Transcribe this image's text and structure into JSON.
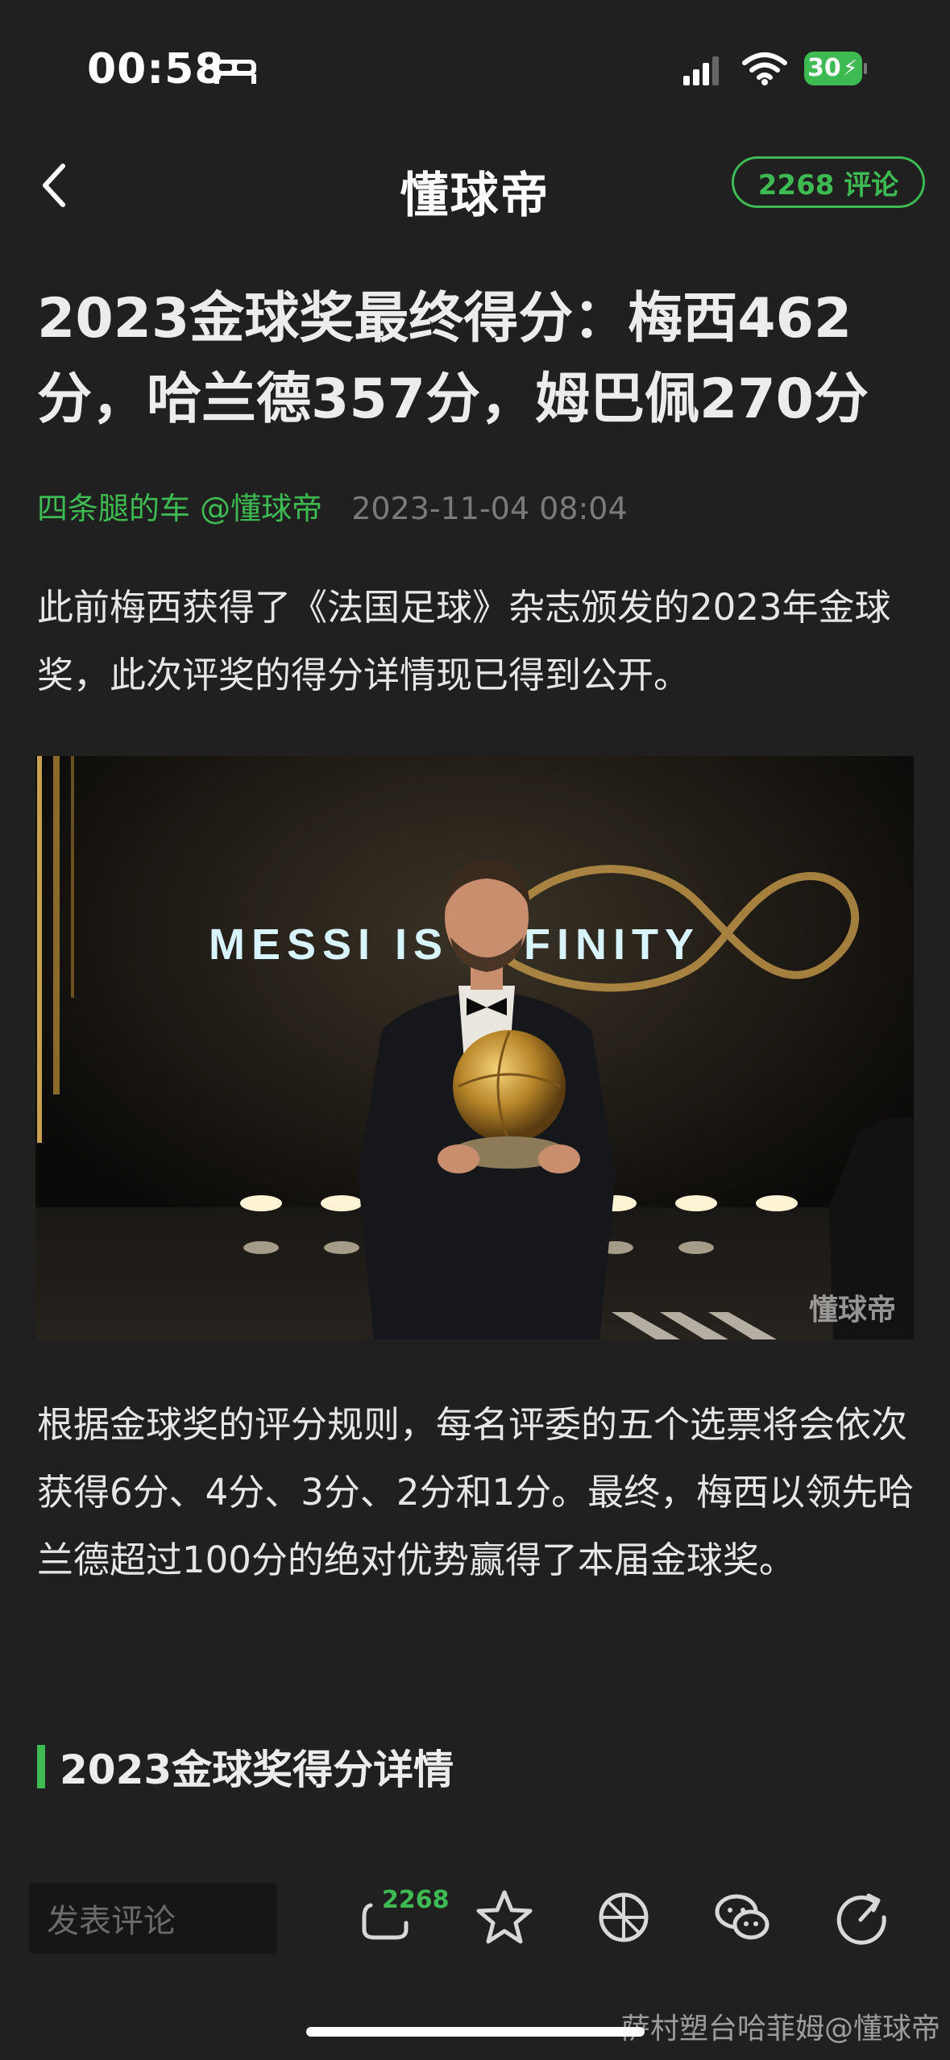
{
  "status_bar": {
    "time": "00:58",
    "battery_level": "30",
    "icons": [
      "bed-icon",
      "signal-icon",
      "wifi-icon",
      "battery-icon"
    ]
  },
  "nav": {
    "back_icon": "chevron-left-icon",
    "logo": "懂球帝",
    "comment_button": "2268 评论"
  },
  "article": {
    "title": "2023金球奖最终得分：梅西462分，哈兰德357分，姆巴佩270分",
    "author": "四条腿的车 @懂球帝",
    "date": "2023-11-04 08:04",
    "para1": "此前梅西获得了《法国足球》杂志颁发的2023年金球奖，此次评奖的得分详情现已得到公开。",
    "image": {
      "stage_text": "MESSI IS INFINITY",
      "watermark": "懂球帝"
    },
    "para2": "根据金球奖的评分规则，每名评委的五个选票将会依次获得6分、4分、3分、2分和1分。最终，梅西以领先哈兰德超过100分的绝对优势赢得了本届金球奖。",
    "section_heading": "2023金球奖得分详情"
  },
  "bottom_bar": {
    "comment_placeholder": "发表评论",
    "comment_count": "2268",
    "icons": [
      "comment-icon",
      "star-icon",
      "moments-icon",
      "wechat-icon",
      "share-icon"
    ]
  },
  "overlay_watermark": "萨村塑台哈菲姆@懂球帝",
  "colors": {
    "background": "#202020",
    "accent": "#3dbb52",
    "text": "#e6e6e6",
    "muted": "#7a7a7a"
  }
}
